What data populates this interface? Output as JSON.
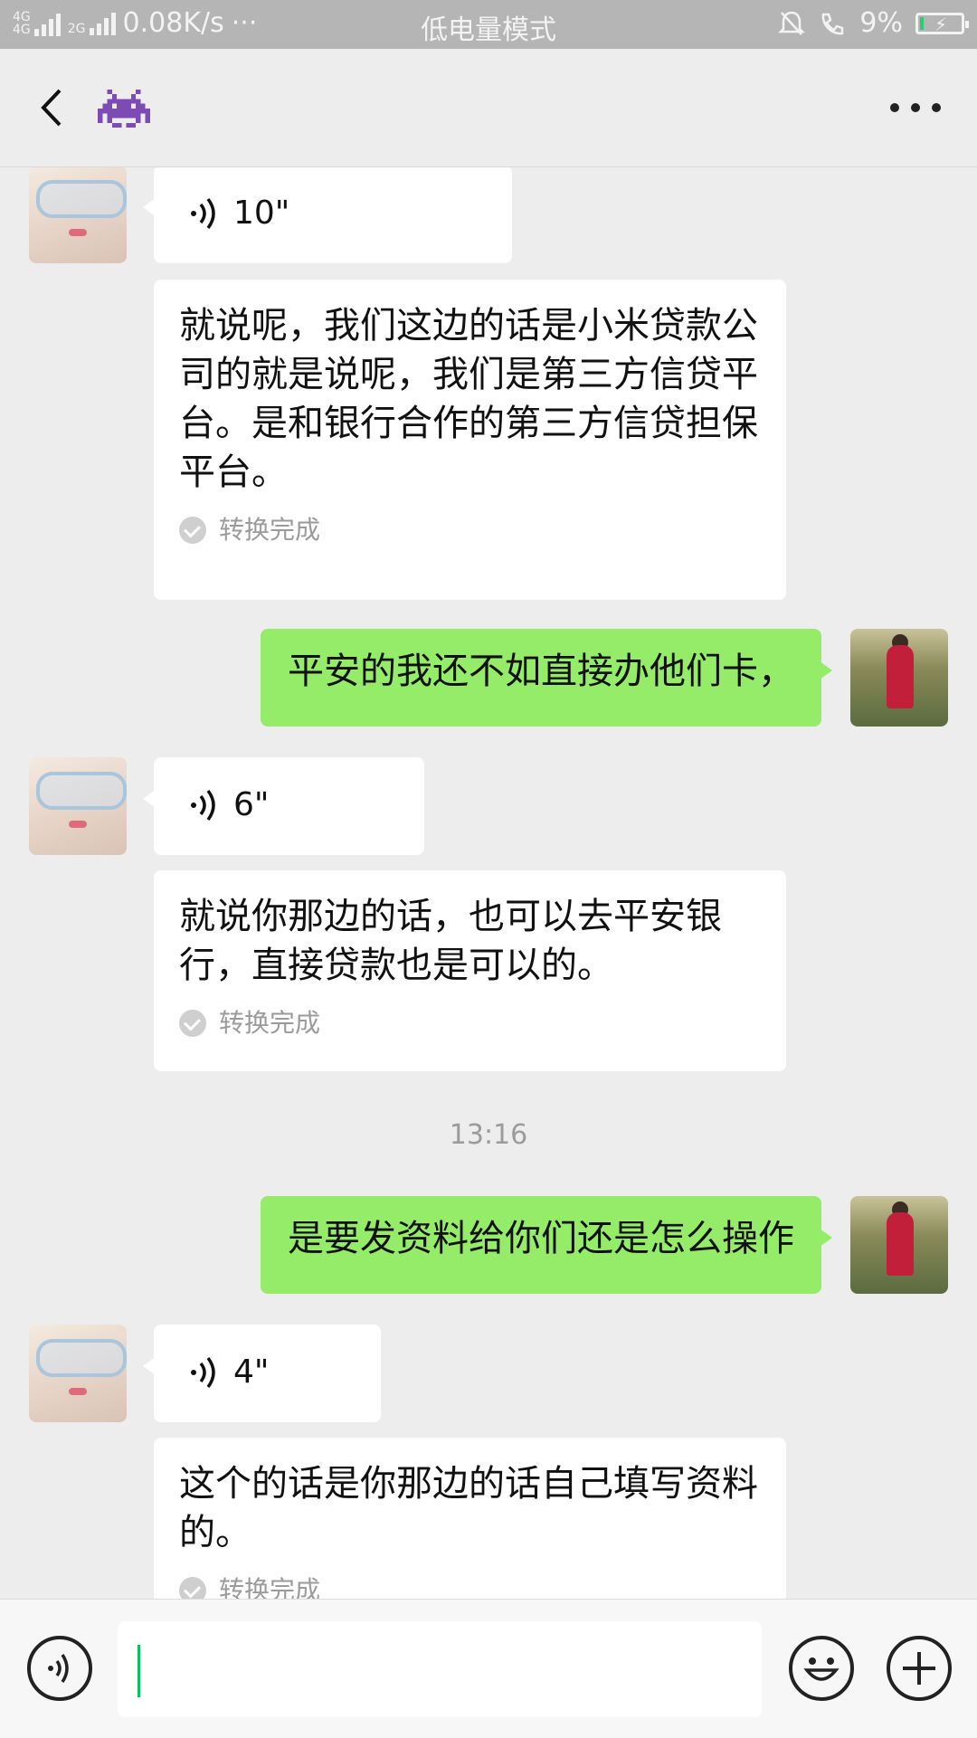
{
  "status_bar": {
    "network_label_1": "4G",
    "network_label_2": "4G",
    "network_label_3": "2G",
    "speed": "0.08K/s",
    "dots": "···",
    "mode": "低电量模式",
    "battery": "9%",
    "battery_level_percent": 9
  },
  "header": {
    "back_icon": "chevron-left-icon",
    "title_icon": "space-invader-icon",
    "more_icon": "more-dots-icon"
  },
  "messages": [
    {
      "side": "left",
      "type": "voice",
      "duration": "10\""
    },
    {
      "side": "left",
      "type": "transcript",
      "text": "就说呢，我们这边的话是小米贷款公司的就是说呢，我们是第三方信贷平台。是和银行合作的第三方信贷担保平台。",
      "status": "转换完成"
    },
    {
      "side": "right",
      "type": "text",
      "text": "平安的我还不如直接办他们卡，"
    },
    {
      "side": "left",
      "type": "voice",
      "duration": "6\""
    },
    {
      "side": "left",
      "type": "transcript",
      "text": "就说你那边的话，也可以去平安银行，直接贷款也是可以的。",
      "status": "转换完成"
    },
    {
      "type": "time",
      "text": "13:16"
    },
    {
      "side": "right",
      "type": "text",
      "text": "是要发资料给你们还是怎么操作"
    },
    {
      "side": "left",
      "type": "voice",
      "duration": "4\""
    },
    {
      "side": "left",
      "type": "transcript",
      "text": "这个的话是你那边的话自己填写资料的。",
      "status": "转换完成"
    }
  ],
  "input_bar": {
    "voice_icon": "voice-input-icon",
    "emoji_icon": "emoji-icon",
    "plus_icon": "plus-icon",
    "text_value": ""
  },
  "colors": {
    "background": "#ededed",
    "green_bubble": "#95ec69",
    "status_bar": "#b5b5b5",
    "caret": "#07c160"
  }
}
